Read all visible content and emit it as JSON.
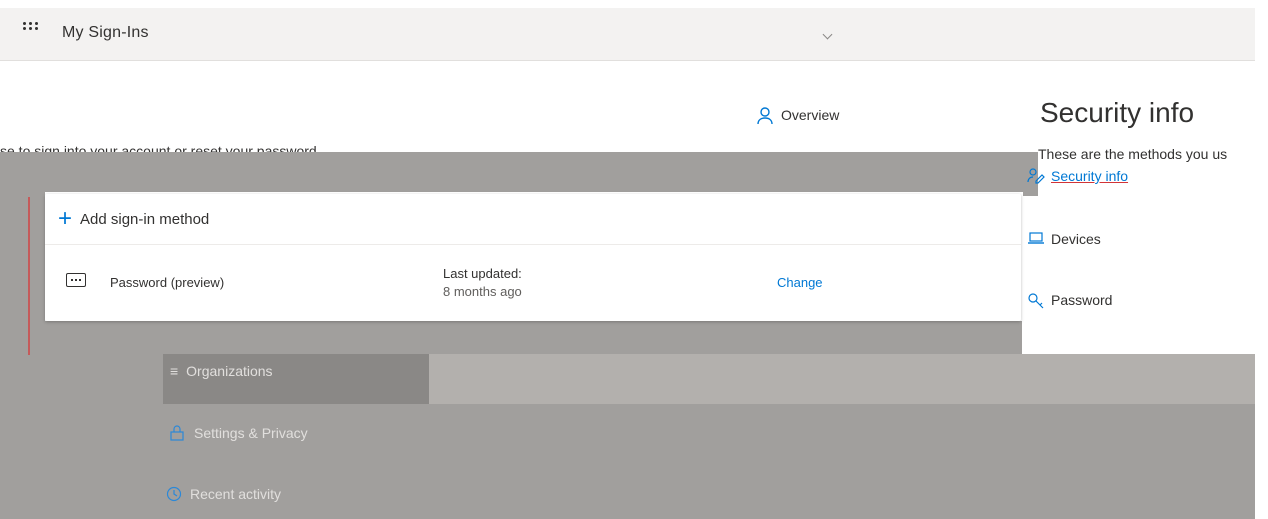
{
  "header": {
    "app_title": "My Sign-Ins",
    "org_switcher": "",
    "waffle_icon": "waffle-icon"
  },
  "intro": {
    "description": "se to sign into your account or reset your password."
  },
  "nav": {
    "overview": "Overview",
    "security_info": "Security info",
    "devices": "Devices",
    "password": "Password",
    "organizations": "Organizations",
    "settings_privacy": "Settings & Privacy",
    "recent_activity": "Recent activity"
  },
  "security": {
    "title": "Security info",
    "description": "These are the methods you us"
  },
  "card": {
    "add_method": "Add sign-in method",
    "methods": [
      {
        "name": "Password (preview)",
        "last_updated_label": "Last updated:",
        "last_updated_value": "8 months ago",
        "action": "Change"
      }
    ]
  },
  "colors": {
    "accent": "#0078d4",
    "overlay": "#a19f9d",
    "header_bg": "#f3f2f1"
  }
}
